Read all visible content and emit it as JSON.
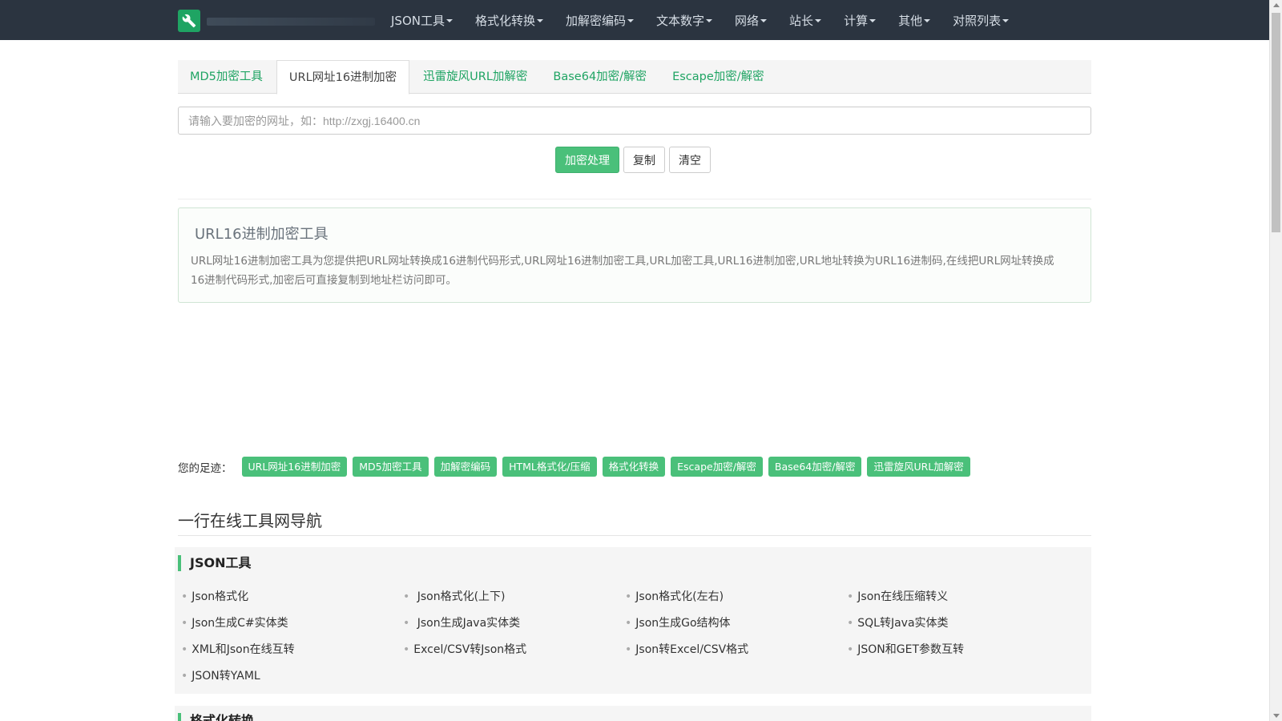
{
  "navbar": {
    "items": [
      {
        "label": "JSON工具"
      },
      {
        "label": "格式化转换"
      },
      {
        "label": "加解密编码"
      },
      {
        "label": "文本数字"
      },
      {
        "label": "网络"
      },
      {
        "label": "站长"
      },
      {
        "label": "计算"
      },
      {
        "label": "其他"
      },
      {
        "label": "对照列表"
      }
    ],
    "logo_icon": "wrench-icon"
  },
  "tabs": [
    {
      "label": "MD5加密工具"
    },
    {
      "label": "URL网址16进制加密"
    },
    {
      "label": "迅雷旋风URL加解密"
    },
    {
      "label": "Base64加密/解密"
    },
    {
      "label": "Escape加密/解密"
    }
  ],
  "input": {
    "placeholder": "请输入要加密的网址，如：http://zxgj.16400.cn",
    "value": ""
  },
  "buttons": {
    "encrypt": "加密处理",
    "copy": "复制",
    "clear": "清空"
  },
  "info": {
    "title": "URL16进制加密工具",
    "description": "URL网址16进制加密工具为您提供把URL网址转换成16进制代码形式,URL网址16进制加密工具,URL加密工具,URL16进制加密,URL地址转换为URL16进制码,在线把URL网址转换成16进制代码形式,加密后可直接复制到地址栏访问即可。"
  },
  "footprint": {
    "label": "您的足迹：",
    "tags": [
      {
        "label": "URL网址16进制加密"
      },
      {
        "label": "MD5加密工具"
      },
      {
        "label": "加解密编码"
      },
      {
        "label": "HTML格式化/压缩"
      },
      {
        "label": "格式化转换"
      },
      {
        "label": "Escape加密/解密"
      },
      {
        "label": "Base64加密/解密"
      },
      {
        "label": "迅雷旋风URL加解密"
      }
    ]
  },
  "section": {
    "title": "一行在线工具网导航"
  },
  "category_json": {
    "title": "JSON工具",
    "links": [
      {
        "label": "Json格式化"
      },
      {
        "label": " Json格式化(上下)"
      },
      {
        "label": "Json格式化(左右)"
      },
      {
        "label": "Json在线压缩转义"
      },
      {
        "label": "Json生成C#实体类"
      },
      {
        "label": " Json生成Java实体类"
      },
      {
        "label": "Json生成Go结构体"
      },
      {
        "label": "SQL转Java实体类"
      },
      {
        "label": "XML和Json在线互转"
      },
      {
        "label": "Excel/CSV转Json格式"
      },
      {
        "label": "Json转Excel/CSV格式"
      },
      {
        "label": "JSON和GET参数互转"
      },
      {
        "label": "JSON转YAML"
      }
    ]
  },
  "category_next": {
    "title": "格式化转换"
  },
  "colors": {
    "navbar_bg": "#2b3440",
    "accent_green": "#4ac07a",
    "tab_text_green": "#1fa463"
  }
}
